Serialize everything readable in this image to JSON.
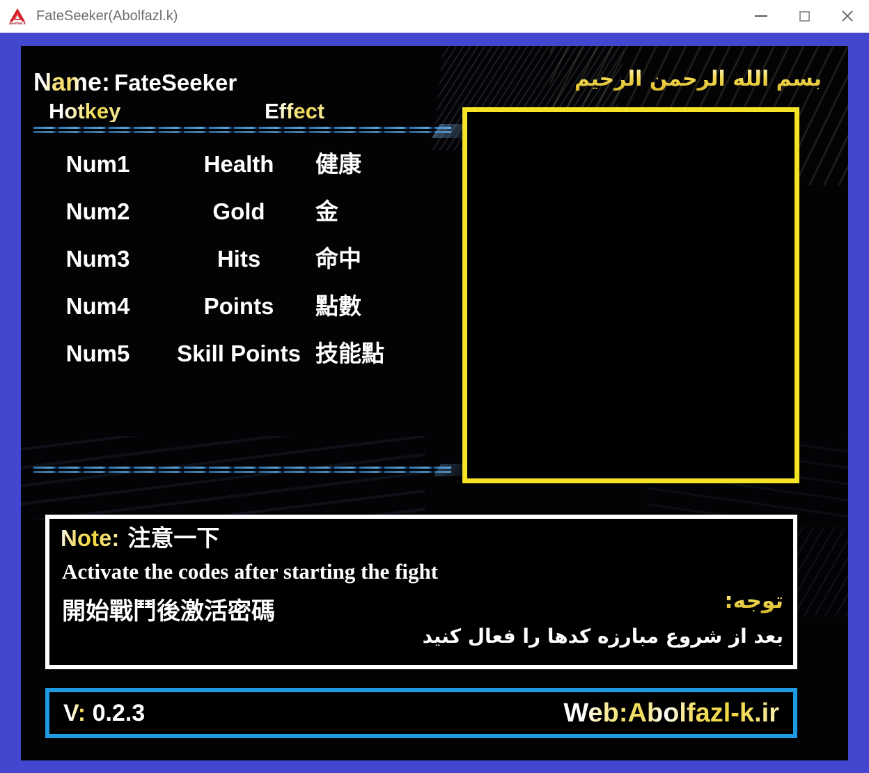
{
  "window": {
    "title": "FateSeeker(Abolfazl.k)",
    "logo_icon": "abolfazl-k-logo-icon",
    "logo_text": "Abolfazl.K",
    "controls": {
      "minimize": "minimize-icon",
      "maximize": "maximize-icon",
      "close": "close-icon"
    },
    "frame_color": "#4346cf"
  },
  "header": {
    "name_label": "Name:",
    "name_value": "FateSeeker",
    "column_hotkey": "Hotkey",
    "column_effect": "Effect",
    "bismillah": "بسم الله الرحمن الرحيم"
  },
  "hotkeys": [
    {
      "key": "Num1",
      "effect_en": "Health",
      "effect_zh": "健康"
    },
    {
      "key": "Num2",
      "effect_en": "Gold",
      "effect_zh": "金"
    },
    {
      "key": "Num3",
      "effect_en": "Hits",
      "effect_zh": "命中"
    },
    {
      "key": "Num4",
      "effect_en": "Points",
      "effect_zh": "點數"
    },
    {
      "key": "Num5",
      "effect_en": "Skill Points",
      "effect_zh": "技能點"
    }
  ],
  "options_panel": {
    "border_color": "#f5e426",
    "content": ""
  },
  "note": {
    "label": "Note:",
    "title_zh": "注意一下",
    "text_en": "Activate the codes after starting the fight",
    "text_zh": "開始戰鬥後激活密碼",
    "label_fa": "توجه:",
    "text_fa": "بعد از شروع مبارزه کدها را فعال کنید",
    "border_color": "#ffffff"
  },
  "footer": {
    "version_label": "V:",
    "version_value": "0.2.3",
    "website": "Web:Abolfazl-k.ir",
    "border_color": "#1f9ae2"
  },
  "colors": {
    "accent_yellow": "#f5e426",
    "accent_blue": "#1f9ae2",
    "frame_blue": "#4346cf",
    "stage_black": "#030305"
  }
}
